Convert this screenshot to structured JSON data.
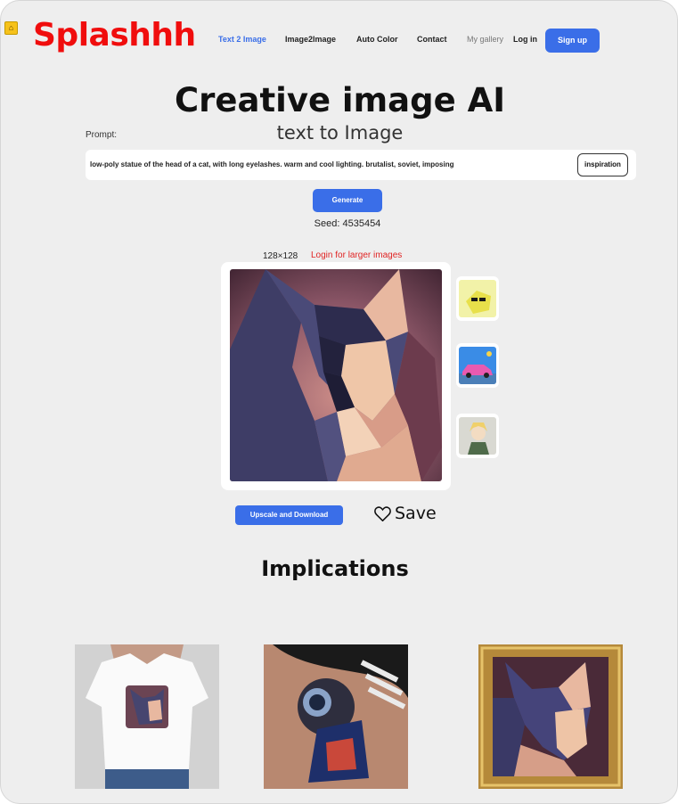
{
  "header": {
    "home_badge": "home-icon",
    "logo": "Splashhh",
    "nav": [
      "Text 2 Image",
      "Image2Image",
      "Auto Color",
      "Contact",
      "My gallery",
      "Log in"
    ],
    "signup": "Sign up",
    "accent_color": "#3a6ee8",
    "logo_color": "#f00d0d"
  },
  "hero": {
    "title": "Creative image AI",
    "subtitle": "text to Image"
  },
  "prompt": {
    "label": "Prompt:",
    "value": "low-poly statue of the head of a cat, with long eyelashes. warm and cool lighting. brutalist, soviet, imposing",
    "inspiration_button": "inspiration"
  },
  "generate_button": "Generate",
  "seed": "Seed: 4535454",
  "result": {
    "size": "128×128",
    "login_note": "Login for larger images",
    "thumbnails": [
      "yellow cat figurine with sunglasses",
      "pink car under blue sky",
      "anime character in green jacket"
    ]
  },
  "actions": {
    "upscale": "Upscale and Download",
    "save": "Save",
    "save_icon": "heart-icon"
  },
  "implications": {
    "title": "Implications",
    "items": [
      "t-shirt print",
      "tattoo",
      "framed picture"
    ]
  }
}
